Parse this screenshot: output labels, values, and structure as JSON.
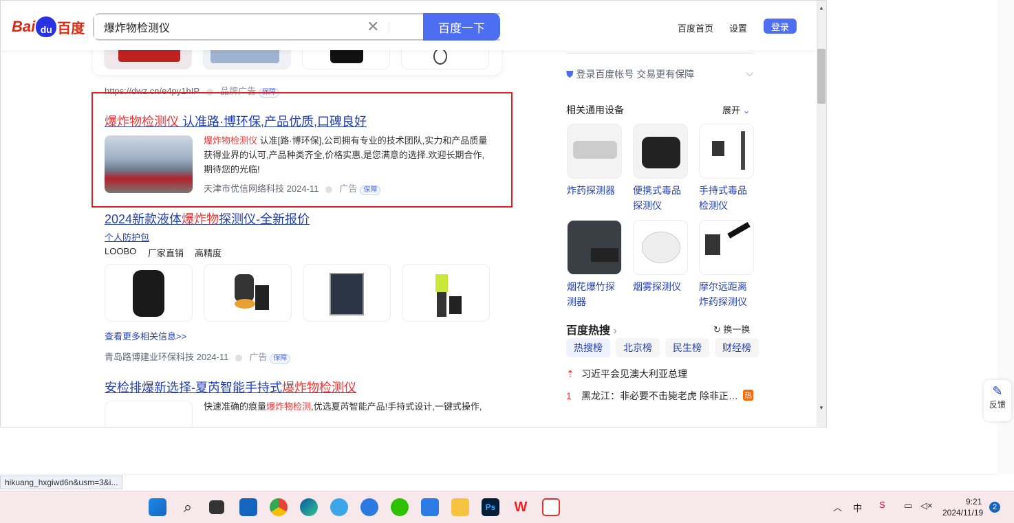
{
  "search": {
    "query": "爆炸物检测仪",
    "button": "百度一下"
  },
  "logo": {
    "bai": "Bai",
    "du": "du",
    "cn": "百度"
  },
  "header": {
    "home": "百度首页",
    "settings": "设置",
    "login": "登录"
  },
  "ad1": {
    "url": "https://dwz.cn/e4py1hIP",
    "tag": "品牌广告",
    "badge": "保障"
  },
  "result1": {
    "title_red": "爆炸物检测仪",
    "title_rest": " 认准路·博环保,产品优质,口碑良好",
    "desc_red": "爆炸物检测仪",
    "desc_rest": " 认准[路·博环保],公司拥有专业的技术团队,实力和产品质量获得业界的认可,产品种类齐全,价格实惠,是您满意的选择.欢迎长期合作,期待您的光临!",
    "source": "天津市优信网络科技",
    "date": "2024-11",
    "ad": "广告",
    "badge": "保障"
  },
  "result2": {
    "title_a": "2024新款液体",
    "title_red": "爆炸物",
    "title_b": "探测仪-全新报价",
    "sublink": "个人防护包",
    "tags": [
      "LOOBO",
      "厂家直销",
      "高精度"
    ],
    "more": "查看更多相关信息>>",
    "source": "青岛路博建业环保科技",
    "date": "2024-11",
    "ad": "广告",
    "badge": "保障"
  },
  "result3": {
    "title_a": "安检排爆新选择-夏芮智能手持式",
    "title_red": "爆炸物检测仪",
    "desc_a": "快速准确的痕量",
    "desc_red": "爆炸物检测",
    "desc_b": ",优选夏芮智能产品!手持式设计,一键式操作,"
  },
  "right": {
    "login_tip": "登录百度帐号 交易更有保障",
    "related_title": "相关通用设备",
    "expand": "展开",
    "devices": [
      {
        "line1": "炸药探测器",
        "line2": ""
      },
      {
        "line1": "便携式毒品",
        "line2": "探测仪"
      },
      {
        "line1": "手持式毒品",
        "line2": "检测仪"
      },
      {
        "line1": "烟花爆竹探",
        "line2": "测器"
      },
      {
        "line1": "烟雾探测仪",
        "line2": ""
      },
      {
        "line1": "摩尔远距离",
        "line2": "炸药探测仪"
      }
    ],
    "hot_title": "百度热搜",
    "refresh": "换一换",
    "hot_tabs": [
      "热搜榜",
      "北京榜",
      "民生榜",
      "财经榜"
    ],
    "hot_items": [
      {
        "rank": "",
        "text": "习近平会见澳大利亚总理",
        "tag": ""
      },
      {
        "rank": "1",
        "text": "黑龙江：非必要不击毙老虎 除非正…",
        "tag": "热"
      }
    ]
  },
  "status_url": "hikuang_hxgiwd6n&usm=3&i...",
  "feedback": "反馈",
  "tray": {
    "ime": "中",
    "time": "9:21",
    "date": "2024/11/19",
    "notif": "2"
  }
}
